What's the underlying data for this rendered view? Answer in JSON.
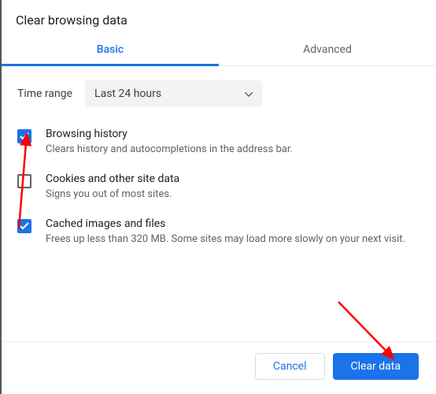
{
  "dialog": {
    "title": "Clear browsing data"
  },
  "tabs": {
    "basic": "Basic",
    "advanced": "Advanced",
    "active": "basic"
  },
  "time_range": {
    "label": "Time range",
    "selected": "Last 24 hours"
  },
  "options": [
    {
      "key": "browsing-history",
      "title": "Browsing history",
      "description": "Clears history and autocompletions in the address bar.",
      "checked": true
    },
    {
      "key": "cookies",
      "title": "Cookies and other site data",
      "description": "Signs you out of most sites.",
      "checked": false
    },
    {
      "key": "cache",
      "title": "Cached images and files",
      "description": "Frees up less than 320 MB. Some sites may load more slowly on your next visit.",
      "checked": true
    }
  ],
  "footer": {
    "cancel": "Cancel",
    "confirm": "Clear data"
  },
  "colors": {
    "primary": "#1a73e8",
    "text": "#202124",
    "muted": "#5f6368",
    "annotation": "#ff0000"
  }
}
